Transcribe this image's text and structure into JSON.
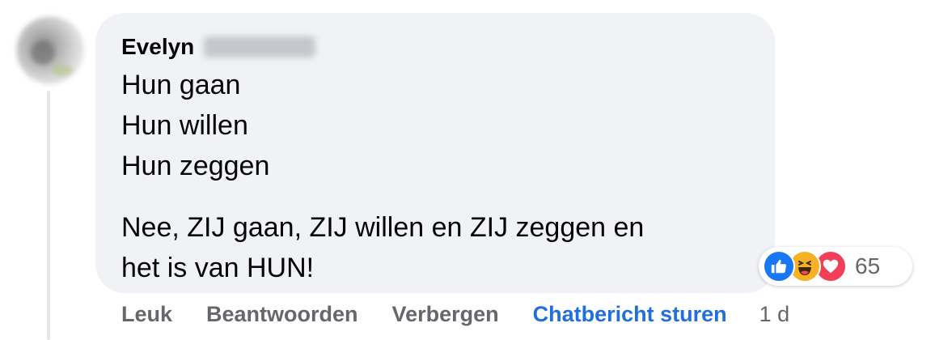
{
  "comment": {
    "author_first_name": "Evelyn",
    "lines": [
      "Hun gaan",
      "Hun willen",
      "Hun zeggen"
    ],
    "paragraph2": [
      "Nee, ZIJ gaan, ZIJ willen en ZIJ zeggen en",
      "het is van HUN!"
    ]
  },
  "reactions": {
    "icons": [
      "like-icon",
      "haha-icon",
      "love-icon"
    ],
    "colors": {
      "like": "#1877f2",
      "haha": "#f7b125",
      "love": "#f33e58"
    },
    "count": "65"
  },
  "actions": {
    "like": "Leuk",
    "reply": "Beantwoorden",
    "hide": "Verbergen",
    "message": "Chatbericht sturen",
    "time": "1 d"
  },
  "colors": {
    "bubble_bg": "#f0f2f5",
    "action_text": "#65676b",
    "link_blue": "#216fdb"
  }
}
